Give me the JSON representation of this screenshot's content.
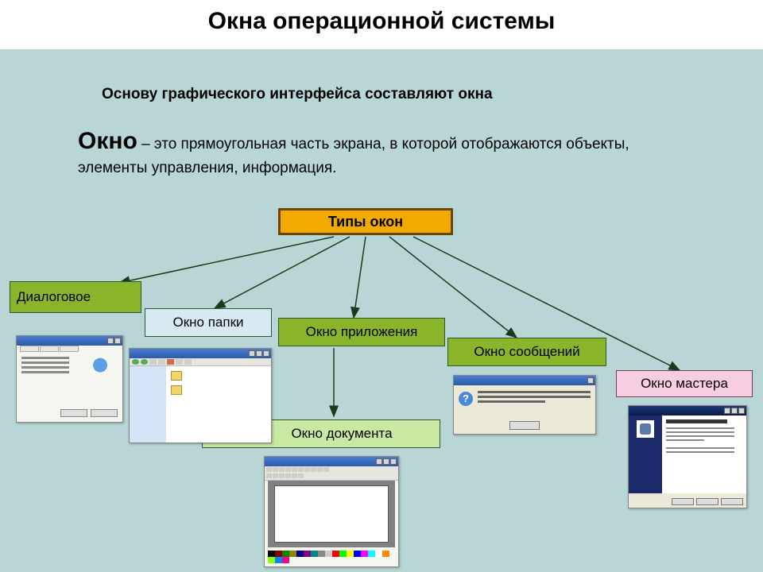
{
  "title": "Окна операционной системы",
  "intro": "Основу графического интерфейса составляют окна",
  "definition_term": "Окно",
  "definition_text": " – это прямоугольная часть экрана, в которой отображаются объекты, элементы управления, информация.",
  "root": "Типы окон",
  "types": {
    "dialog": "Диалоговое",
    "folder": "Окно папки",
    "app": "Окно приложения",
    "msg": "Окно сообщений",
    "wizard": "Окно мастера",
    "doc": "Окно документа"
  },
  "palette_colors": [
    "#000",
    "#800",
    "#080",
    "#880",
    "#008",
    "#808",
    "#088",
    "#888",
    "#ccc",
    "#f00",
    "#0f0",
    "#ff0",
    "#00f",
    "#f0f",
    "#0ff",
    "#fff",
    "#f80",
    "#8f0",
    "#08f",
    "#f08"
  ]
}
